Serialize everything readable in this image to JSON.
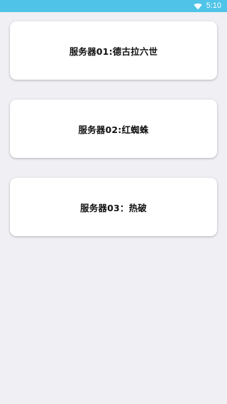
{
  "status_bar": {
    "time": "5:10",
    "background_color": "#4fc3e8",
    "icons": [
      "wifi-icon"
    ]
  },
  "servers": [
    {
      "label": "服务器01:德古拉六世"
    },
    {
      "label": "服务器02:红蜘蛛"
    },
    {
      "label": "服务器03：热破"
    }
  ]
}
